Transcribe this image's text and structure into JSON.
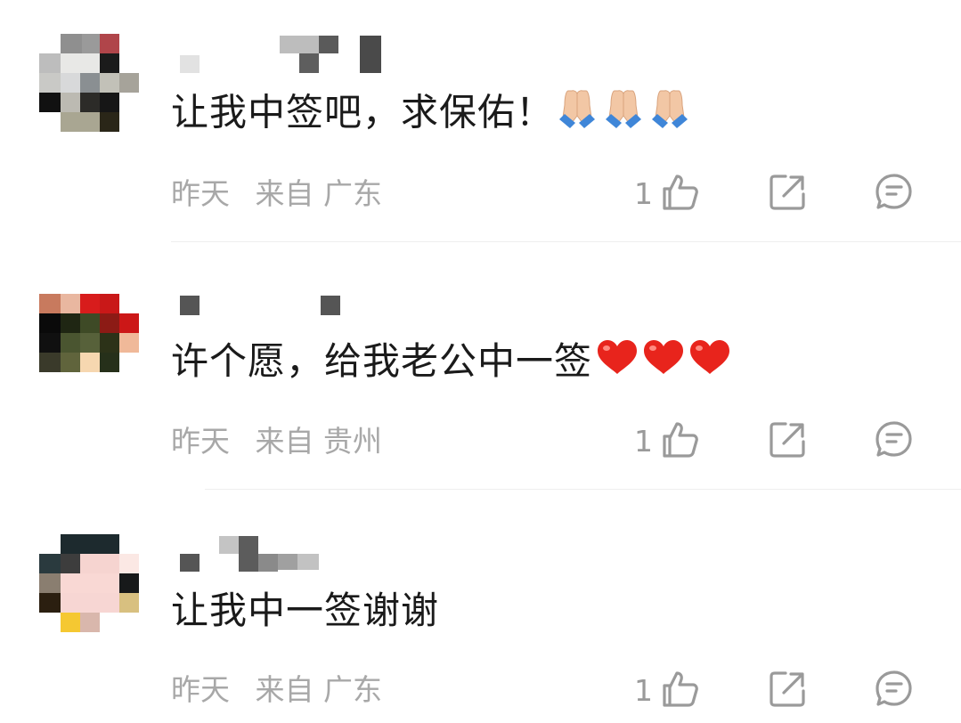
{
  "comments": [
    {
      "text": "让我中签吧，求保佑！",
      "emoji": "pray-x3",
      "time": "昨天",
      "location": "来自 广东",
      "likes": "1"
    },
    {
      "text": "许个愿，给我老公中一签",
      "emoji": "heart-x3",
      "time": "昨天",
      "location": "来自 贵州",
      "likes": "1"
    },
    {
      "text": "让我中一签谢谢",
      "emoji": "",
      "time": "昨天",
      "location": "来自 广东",
      "likes": "1"
    }
  ],
  "icons": {
    "like": "thumbs-up-icon",
    "share": "share-icon",
    "reply": "comment-icon"
  },
  "colors": {
    "text": "#1a1a1a",
    "meta": "#a8a8a8",
    "icon": "#9a9a9a",
    "heart": "#e8241c"
  }
}
